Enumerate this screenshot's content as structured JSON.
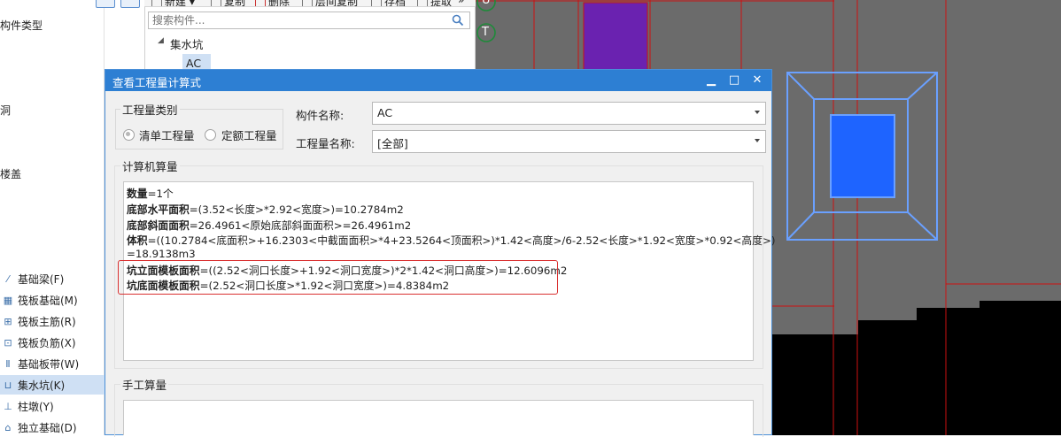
{
  "toolbar": {
    "new_label": "新建",
    "copy_label": "复制",
    "delete_label": "删除",
    "floor_copy_label": "层间复制",
    "save_label": "存档",
    "extract_label": "提取",
    "more_label": "»"
  },
  "left_panel": {
    "header": "构件类型",
    "labels": [
      "洞",
      "楼盖"
    ],
    "items": [
      {
        "label": "基础梁(F)",
        "icon": "beam-icon"
      },
      {
        "label": "筏板基础(M)",
        "icon": "raft-icon"
      },
      {
        "label": "筏板主筋(R)",
        "icon": "rebar-icon"
      },
      {
        "label": "筏板负筋(X)",
        "icon": "neg-rebar-icon"
      },
      {
        "label": "基础板带(W)",
        "icon": "strip-icon"
      },
      {
        "label": "集水坑(K)",
        "icon": "pit-icon",
        "selected": true
      },
      {
        "label": "柱墩(Y)",
        "icon": "pier-icon"
      },
      {
        "label": "独立基础(D)",
        "icon": "footing-icon"
      }
    ]
  },
  "component_panel": {
    "search_placeholder": "搜索构件...",
    "tree_root": "集水坑",
    "tree_child": "AC"
  },
  "cad": {
    "axis_labels": [
      "U",
      "T"
    ]
  },
  "dialog": {
    "title": "查看工程量计算式",
    "quantity_type_group": "工程量类别",
    "radio_list": "清单工程量",
    "radio_quota": "定额工程量",
    "component_name_label": "构件名称:",
    "component_name_value": "AC",
    "quantity_name_label": "工程量名称:",
    "quantity_name_value": "[全部]",
    "computer_section": "计算机算量",
    "manual_section": "手工算量",
    "calc_lines": [
      {
        "name": "数量",
        "expr": "=1个"
      },
      {
        "name": "底部水平面积",
        "expr": "=(3.52<长度>*2.92<宽度>)=10.2784m2"
      },
      {
        "name": "底部斜面面积",
        "expr": "=26.4961<原始底部斜面面积>=26.4961m2"
      },
      {
        "name": "体积",
        "expr": "=((10.2784<底面积>+16.2303<中截面面积>*4+23.5264<顶面积>)*1.42<高度>/6-2.52<长度>*1.92<宽度>*0.92<高度>)"
      },
      {
        "name": "",
        "expr": "=18.9138m3"
      },
      {
        "name": "坑立面模板面积",
        "expr": "=((2.52<洞口长度>+1.92<洞口宽度>)*2*1.42<洞口高度>)=12.6096m2"
      },
      {
        "name": "坑底面模板面积",
        "expr": "=(2.52<洞口长度>*1.92<洞口宽度>)=4.8384m2"
      }
    ]
  },
  "colors": {
    "title_bar": "#2d7fd3",
    "highlight": "#d93030",
    "cad_bg": "#6b6b6b",
    "purple_block": "#6a22b0",
    "blue_block": "#1e64ff",
    "wire": "#6aa0ff",
    "cad_red": "#cc1010"
  }
}
